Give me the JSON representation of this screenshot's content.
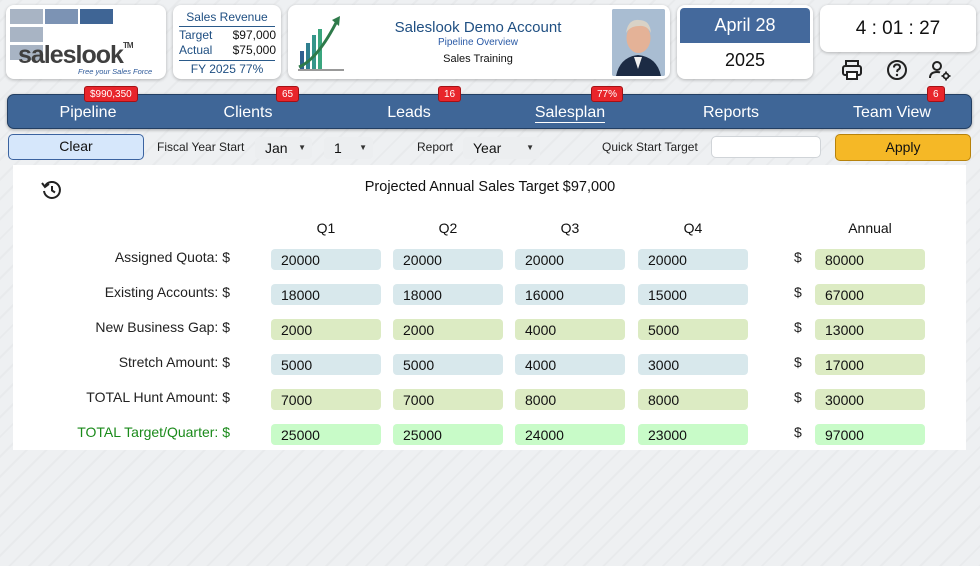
{
  "logo": {
    "brand": "saleslook",
    "tm": "TM",
    "tagline": "Free your Sales Force"
  },
  "revenue": {
    "title": "Sales Revenue",
    "target_label": "Target",
    "target_value": "$97,000",
    "actual_label": "Actual",
    "actual_value": "$75,000",
    "fy": "FY 2025  77%"
  },
  "account": {
    "name": "Saleslook Demo Account",
    "subtitle": "Pipeline Overview",
    "training": "Sales Training"
  },
  "date": {
    "month_day": "April 28",
    "year": "2025"
  },
  "time": "4 : 01 : 27",
  "icons": [
    "printer-icon",
    "help-icon",
    "user-settings-icon",
    "history-icon"
  ],
  "nav": {
    "tabs": [
      {
        "label": "Pipeline",
        "badge": "$990,350"
      },
      {
        "label": "Clients",
        "badge": "65"
      },
      {
        "label": "Leads",
        "badge": "16"
      },
      {
        "label": "Salesplan",
        "badge": "77%",
        "active": true
      },
      {
        "label": "Reports",
        "badge": ""
      },
      {
        "label": "Team View",
        "badge": "6"
      }
    ]
  },
  "controls": {
    "clear": "Clear",
    "fiscal_label": "Fiscal Year Start",
    "month": "Jan",
    "day": "1",
    "report_label": "Report",
    "report_value": "Year",
    "quick_label": "Quick Start Target",
    "quick_value": "",
    "apply": "Apply"
  },
  "plan": {
    "title": "Projected Annual Sales Target $97,000",
    "columns": [
      "Q1",
      "Q2",
      "Q3",
      "Q4",
      "Annual"
    ],
    "currency": "$",
    "rows": [
      {
        "label": "Assigned Quota: $",
        "values": [
          "20000",
          "20000",
          "20000",
          "20000"
        ],
        "annual": "80000"
      },
      {
        "label": "Existing Accounts: $",
        "values": [
          "18000",
          "18000",
          "16000",
          "15000"
        ],
        "annual": "67000"
      },
      {
        "label": "New Business Gap: $",
        "values": [
          "2000",
          "2000",
          "4000",
          "5000"
        ],
        "annual": "13000"
      },
      {
        "label": "Stretch Amount: $",
        "values": [
          "5000",
          "5000",
          "4000",
          "3000"
        ],
        "annual": "17000"
      },
      {
        "label": "TOTAL Hunt Amount: $",
        "values": [
          "7000",
          "7000",
          "8000",
          "8000"
        ],
        "annual": "30000"
      },
      {
        "label": "TOTAL Target/Quarter: $",
        "values": [
          "25000",
          "25000",
          "24000",
          "23000"
        ],
        "annual": "97000"
      }
    ]
  },
  "colors": {
    "nav": "#3f6697",
    "apply": "#f5b826",
    "badge": "#e8252b",
    "clear": "#d6e7fb"
  }
}
